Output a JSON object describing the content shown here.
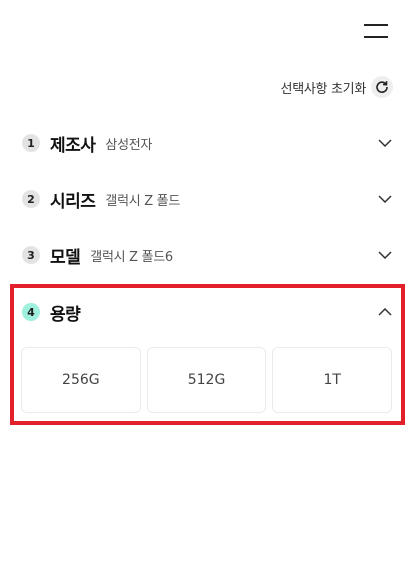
{
  "header": {
    "menu_icon": "hamburger-icon"
  },
  "reset": {
    "label": "선택사항 초기화",
    "icon": "refresh-icon"
  },
  "steps": [
    {
      "number": "1",
      "title": "제조사",
      "value": "삼성전자",
      "state": "collapsed"
    },
    {
      "number": "2",
      "title": "시리즈",
      "value": "갤럭시 Z 폴드",
      "state": "collapsed"
    },
    {
      "number": "3",
      "title": "모델",
      "value": "갤럭시 Z 폴드6",
      "state": "collapsed"
    },
    {
      "number": "4",
      "title": "용량",
      "value": "",
      "state": "expanded"
    }
  ],
  "capacity_options": [
    "256G",
    "512G",
    "1T"
  ],
  "colors": {
    "active_step_badge": "#9ff0dc",
    "inactive_step_badge": "#e3e3e3",
    "highlight_border": "#e1202a"
  }
}
